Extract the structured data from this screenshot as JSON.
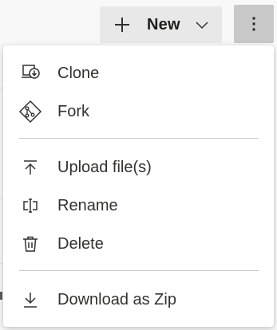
{
  "toolbar": {
    "new_label": "New",
    "icons": {
      "new": "plus-icon",
      "new_dropdown": "chevron-down-icon",
      "more": "vertical-ellipsis-icon"
    }
  },
  "menu": {
    "items": [
      {
        "label": "Clone",
        "icon": "clone-icon"
      },
      {
        "label": "Fork",
        "icon": "fork-icon"
      },
      {
        "label": "Upload file(s)",
        "icon": "upload-icon"
      },
      {
        "label": "Rename",
        "icon": "rename-icon"
      },
      {
        "label": "Delete",
        "icon": "trash-icon"
      },
      {
        "label": "Download as Zip",
        "icon": "download-icon"
      }
    ]
  },
  "colors": {
    "text": "#323130",
    "menu_bg": "#ffffff",
    "button_bg": "#e8e8e8",
    "more_button_bg": "#c8c8c8",
    "divider": "#c8c8c8",
    "page_bg": "#f8f8f8"
  }
}
